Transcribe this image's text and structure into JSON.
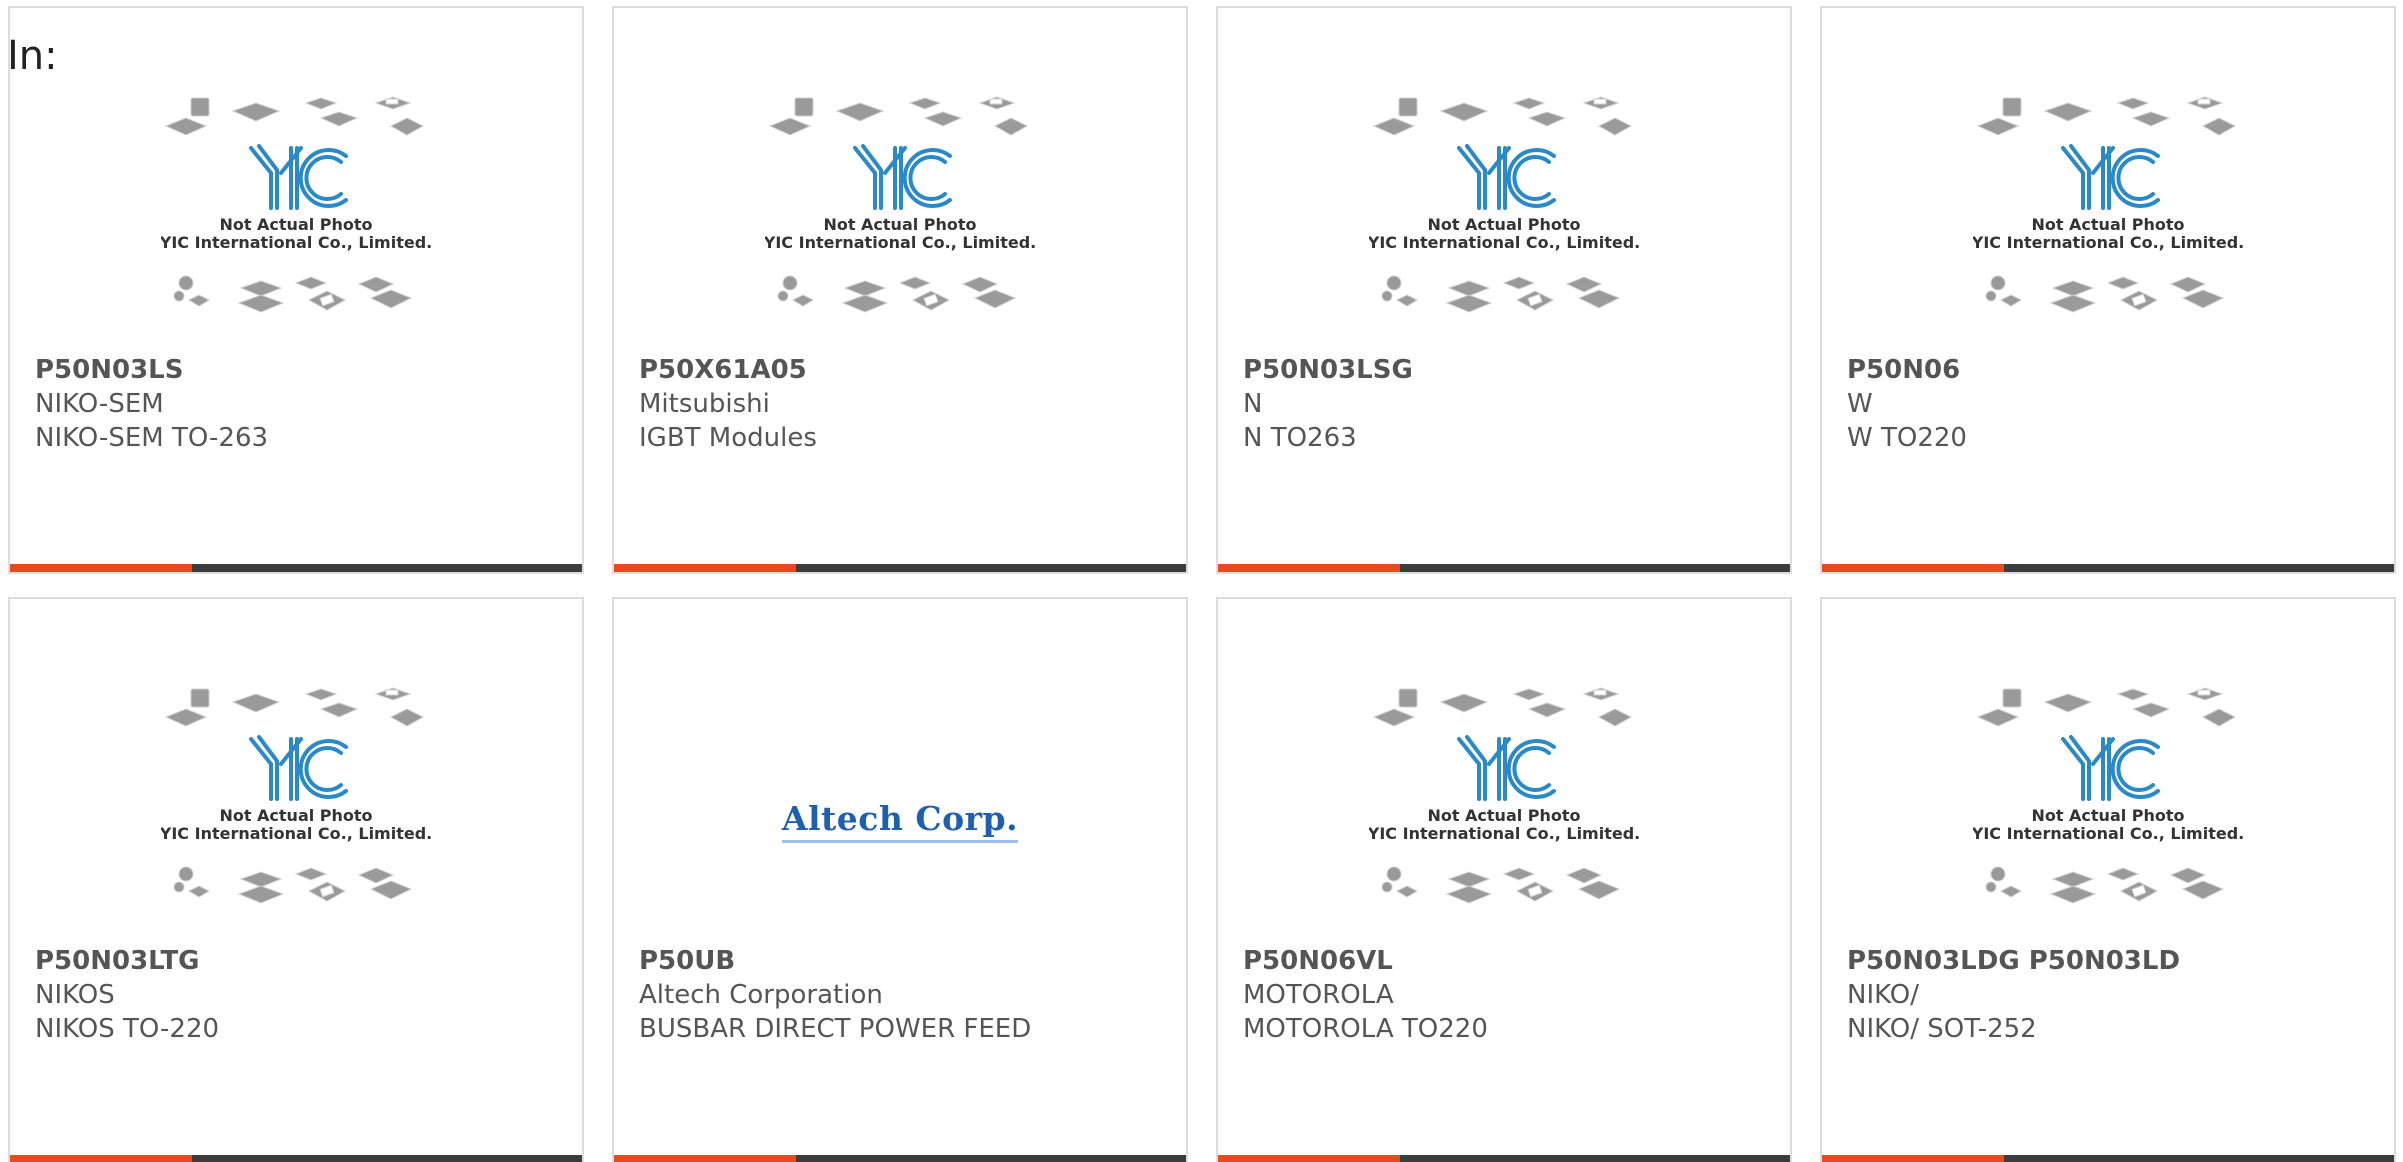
{
  "header": {
    "label": "In:"
  },
  "placeholder": {
    "line1": "Not Actual Photo",
    "line2": "YIC International Co., Limited.",
    "logo": "YIC"
  },
  "accent_color": "#e84a1f",
  "bar_color": "#3c3c3c",
  "products": [
    {
      "part": "P50N03LS",
      "maker": "NIKO-SEM",
      "desc": "NIKO-SEM TO-263",
      "image": "yic-placeholder"
    },
    {
      "part": "P50X61A05",
      "maker": "Mitsubishi",
      "desc": "IGBT Modules",
      "image": "yic-placeholder"
    },
    {
      "part": "P50N03LSG",
      "maker": "N",
      "desc": "N TO263",
      "image": "yic-placeholder"
    },
    {
      "part": "P50N06",
      "maker": "W",
      "desc": "W TO220",
      "image": "yic-placeholder"
    },
    {
      "part": "P50N03LTG",
      "maker": "NIKOS",
      "desc": "NIKOS TO-220",
      "image": "yic-placeholder"
    },
    {
      "part": "P50UB",
      "maker": "Altech Corporation",
      "desc": "BUSBAR DIRECT POWER FEED",
      "image": "altech-logo",
      "logo_text": "Altech Corp."
    },
    {
      "part": "P50N06VL",
      "maker": "MOTOROLA",
      "desc": "MOTOROLA TO220",
      "image": "yic-placeholder"
    },
    {
      "part": "P50N03LDG P50N03LD",
      "maker": "NIKO/",
      "desc": "NIKO/ SOT-252",
      "image": "yic-placeholder"
    }
  ]
}
